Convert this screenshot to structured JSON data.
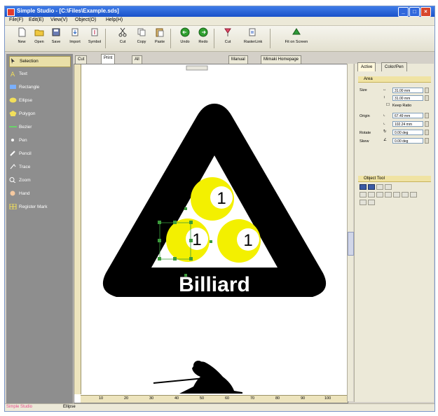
{
  "window": {
    "title": "Simple Studio - [C:\\Files\\Example.sds]",
    "controls": [
      "_",
      "□",
      "×"
    ]
  },
  "menubar": [
    "File(F)",
    "Edit(E)",
    "View(V)",
    "Object(O)",
    "Help(H)"
  ],
  "toolbar": [
    {
      "label": "New",
      "icon": "new-doc-icon"
    },
    {
      "label": "Open",
      "icon": "folder-icon"
    },
    {
      "label": "Save",
      "icon": "save-icon"
    },
    {
      "label": "Import",
      "icon": "import-icon"
    },
    {
      "label": "Symbol",
      "icon": "symbol-icon"
    },
    {
      "label": "Cut",
      "icon": "scissors-icon"
    },
    {
      "label": "Copy",
      "icon": "copy-icon"
    },
    {
      "label": "Paste",
      "icon": "paste-icon"
    },
    {
      "label": "Undo",
      "icon": "undo-icon"
    },
    {
      "label": "Redo",
      "icon": "redo-icon"
    },
    {
      "label": "Cut",
      "icon": "cut-path-icon"
    },
    {
      "label": "RasterLink",
      "icon": "rasterlink-icon"
    },
    {
      "label": "Fit on Screen",
      "icon": "fit-screen-icon"
    }
  ],
  "tools": [
    {
      "label": "Selection",
      "icon": "selection-arrow-icon",
      "active": true
    },
    {
      "label": "Text",
      "icon": "text-icon"
    },
    {
      "label": "Rectangle",
      "icon": "rectangle-icon"
    },
    {
      "label": "Ellipse",
      "icon": "ellipse-icon"
    },
    {
      "label": "Polygon",
      "icon": "polygon-icon"
    },
    {
      "label": "Bezier",
      "icon": "bezier-icon"
    },
    {
      "label": "Pen",
      "icon": "pen-icon"
    },
    {
      "label": "Pencil",
      "icon": "pencil-icon"
    },
    {
      "label": "Trace",
      "icon": "trace-icon"
    },
    {
      "label": "Zoom",
      "icon": "zoom-icon"
    },
    {
      "label": "Hand",
      "icon": "hand-icon"
    },
    {
      "label": "Register Mark",
      "icon": "register-mark-icon"
    }
  ],
  "doc_tabs": [
    {
      "label": "Cut",
      "selected": false
    },
    {
      "label": "Print",
      "selected": true
    },
    {
      "label": "All",
      "selected": false
    }
  ],
  "view_buttons": [
    "Manual",
    "Mimaki Homepage"
  ],
  "right_tabs": [
    {
      "label": "Active",
      "selected": true
    },
    {
      "label": "Color/Pen",
      "selected": false
    }
  ],
  "area": {
    "header": "Area",
    "size_label": "Size",
    "width": "31.00 mm",
    "height": "31.00 mm",
    "keep_ratio": "Keep Ratio",
    "origin_label": "Origin",
    "origin_x": "67.49 mm",
    "origin_y": "102.24 mm",
    "rotate_label": "Rotate",
    "rotate": "0.00 deg",
    "skew_label": "Skew",
    "skew": "0.00 deg"
  },
  "object_tool": {
    "header": "Object Tool"
  },
  "artwork": {
    "ball_number": "1",
    "caption": "Billiard",
    "colors": {
      "ball": "#f3f000",
      "triangle": "#000000"
    }
  },
  "ruler": {
    "h_ticks": [
      "10",
      "20",
      "30",
      "40",
      "50",
      "60",
      "70",
      "80",
      "90",
      "100"
    ]
  },
  "status": {
    "app": "Simple Studio",
    "object": "Ellipse"
  }
}
